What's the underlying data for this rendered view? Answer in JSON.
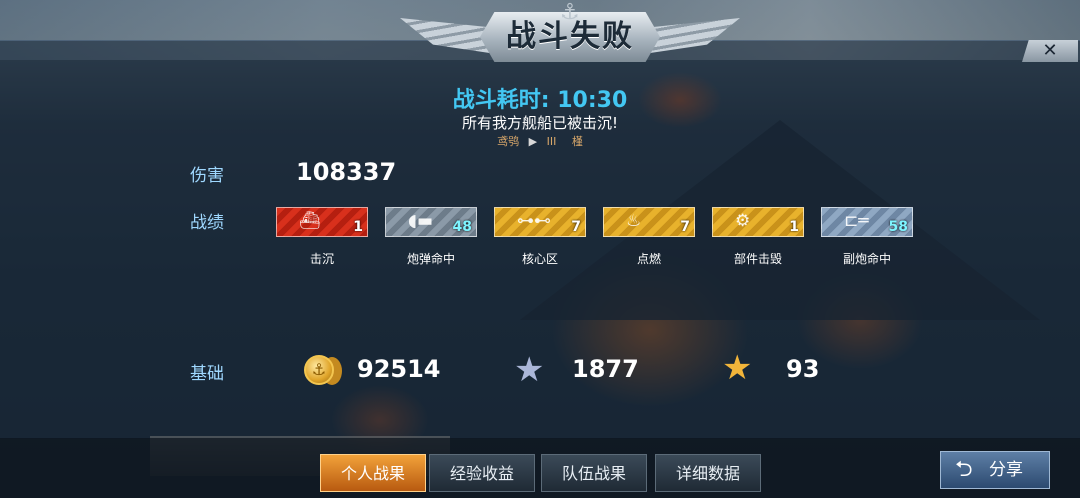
{
  "header": {
    "title": "战斗失败"
  },
  "battle_time": {
    "label": "战斗耗时:",
    "value": "10:30"
  },
  "message": "所有我方舰船已被击沉!",
  "ship_info": {
    "name": "鸢鸮",
    "tier": "III",
    "nation": "槿"
  },
  "damage": {
    "label": "伤害",
    "value": "108337"
  },
  "achievements": {
    "label": "战绩",
    "items": [
      {
        "name": "击沉",
        "count": "1",
        "style": "red",
        "icon": "ship-sinking-icon"
      },
      {
        "name": "炮弹命中",
        "count": "48",
        "style": "gray",
        "icon": "shell-icon"
      },
      {
        "name": "核心区",
        "count": "7",
        "style": "gold",
        "icon": "citadel-icon"
      },
      {
        "name": "点燃",
        "count": "7",
        "style": "gold",
        "icon": "fire-icon"
      },
      {
        "name": "部件击毁",
        "count": "1",
        "style": "gold",
        "icon": "gear-icon"
      },
      {
        "name": "副炮命中",
        "count": "58",
        "style": "blue",
        "icon": "secondary-gun-icon"
      }
    ]
  },
  "base": {
    "label": "基础",
    "credits": "92514",
    "exp": "1877",
    "free_exp": "93"
  },
  "tabs": [
    "个人战果",
    "经验收益",
    "队伍战果",
    "详细数据"
  ],
  "share_label": "分享",
  "close_symbol": "✕"
}
